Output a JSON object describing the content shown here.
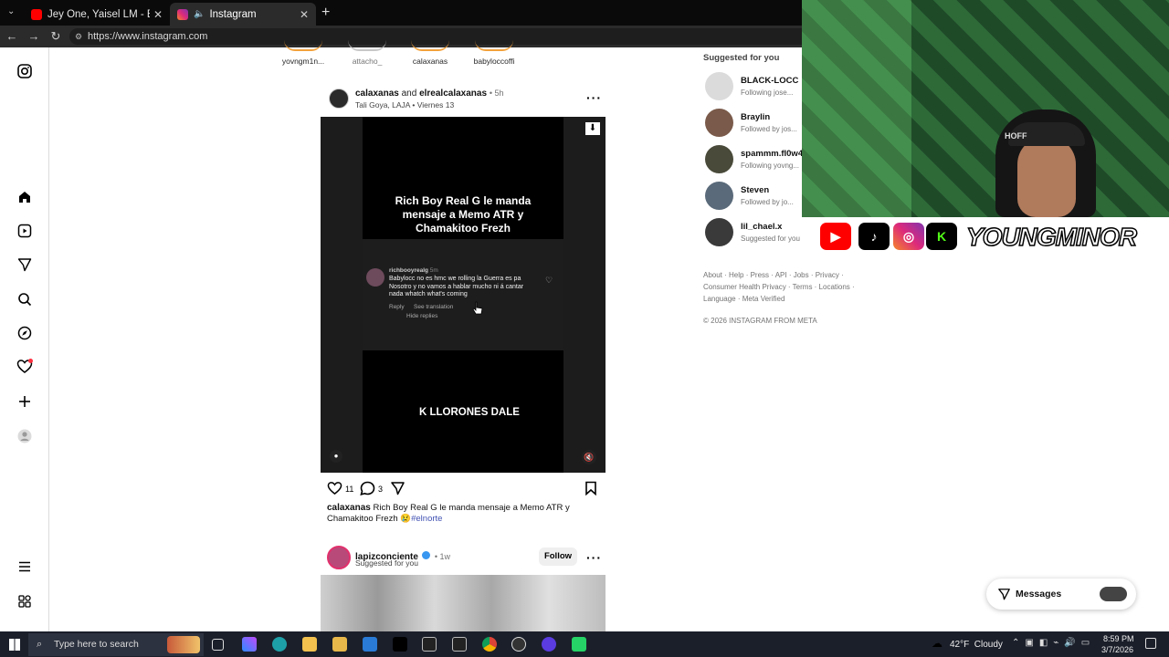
{
  "browser": {
    "tabs": [
      {
        "label": "Jey One, Yaisel LM - Bo De Bo De",
        "icon": "youtube-icon",
        "color": "#ff0000"
      },
      {
        "label": "Instagram",
        "icon": "instagram-icon",
        "color": "#e1306c"
      }
    ],
    "new_tab": "+",
    "url": "https://www.instagram.com"
  },
  "stories": [
    {
      "label": "yovngm1n..."
    },
    {
      "label": "attacho_"
    },
    {
      "label": "calaxanas"
    },
    {
      "label": "babyloccoffi"
    }
  ],
  "post": {
    "user1": "calaxanas",
    "and": "and",
    "user2": "elrealcalaxanas",
    "time": "• 5h",
    "location": "Tali Goya, LAJA • Viernes 13",
    "video": {
      "headline": "Rich Boy Real G le manda mensaje a Memo ATR y Chamakitoo Frezh",
      "comment_user": "richbooyrealg",
      "comment_time": "5m",
      "comment_text": "Babylocc no es hmc we rolling la Guerra es pa Nosotro y no vamos a hablar mucho ni á cantar nada whatch what's coming",
      "reply": "Reply",
      "see_translation": "See translation",
      "hide_replies": "Hide replies",
      "footer_text": "K LLORONES DALE"
    },
    "likes": "11",
    "comments": "3",
    "caption_user": "calaxanas",
    "caption_text": "Rich Boy Real G le manda mensaje a Memo ATR y Chamakitoo Frezh",
    "caption_emoji": "😢",
    "hashtag": "#elnorte"
  },
  "next_post": {
    "user": "lapizconciente",
    "time": "• 1w",
    "sub": "Suggested for you",
    "follow": "Follow"
  },
  "suggestions": {
    "title": "Suggested for you",
    "items": [
      {
        "name": "BLACK-LOCC",
        "sub": "Following jose..."
      },
      {
        "name": "Braylin",
        "sub": "Followed by jos..."
      },
      {
        "name": "spammm.fl0w4",
        "sub": "Following yovng..."
      },
      {
        "name": "Steven",
        "sub": "Followed by jo..."
      },
      {
        "name": "lil_chael.x",
        "sub": "Suggested for you"
      }
    ]
  },
  "footer": {
    "line1": "About · Help · Press · API · Jobs · Privacy ·",
    "line2": "Consumer Health Privacy · Terms · Locations ·",
    "line3": "Language · Meta Verified",
    "copyright": "© 2026 INSTAGRAM FROM META"
  },
  "stream_overlay": {
    "brand": "YOUNGMINOR",
    "cap_text": "HOFF"
  },
  "messages": {
    "label": "Messages"
  },
  "taskbar": {
    "search_placeholder": "Type here to search",
    "weather": "42°F  Cloudy",
    "time": "8:59 PM",
    "date": "3/7/2026"
  }
}
